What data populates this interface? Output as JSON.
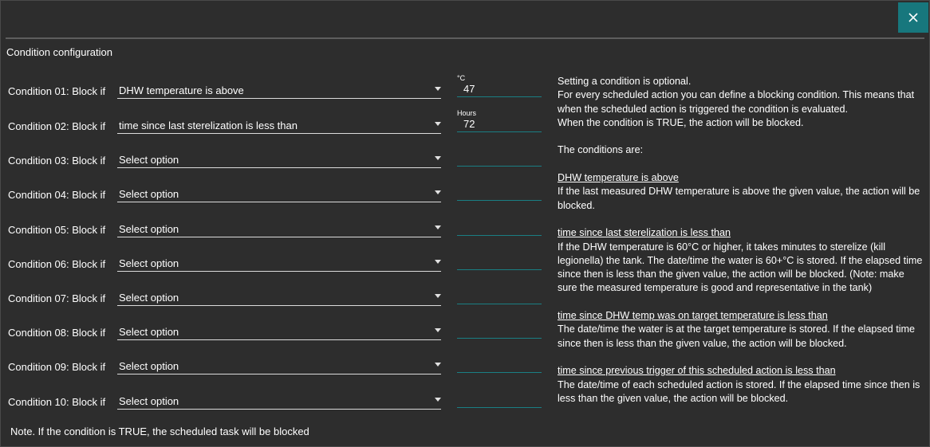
{
  "dialog": {
    "close_icon": "close-icon",
    "section_title": "Condition configuration",
    "accent_color": "#17777d"
  },
  "conditions": [
    {
      "label": "Condition 01: Block if",
      "selected": "DHW temperature is above",
      "unit": "°C",
      "value": "47"
    },
    {
      "label": "Condition 02: Block if",
      "selected": "time since last sterelization is less than",
      "unit": "Hours",
      "value": "72"
    },
    {
      "label": "Condition 03: Block if",
      "selected": "Select option",
      "unit": "",
      "value": ""
    },
    {
      "label": "Condition 04: Block if",
      "selected": "Select option",
      "unit": "",
      "value": ""
    },
    {
      "label": "Condition 05: Block if",
      "selected": "Select option",
      "unit": "",
      "value": ""
    },
    {
      "label": "Condition 06: Block if",
      "selected": "Select option",
      "unit": "",
      "value": ""
    },
    {
      "label": "Condition 07: Block if",
      "selected": "Select option",
      "unit": "",
      "value": ""
    },
    {
      "label": "Condition 08: Block if",
      "selected": "Select option",
      "unit": "",
      "value": ""
    },
    {
      "label": "Condition 09: Block if",
      "selected": "Select option",
      "unit": "",
      "value": ""
    },
    {
      "label": "Condition 10: Block if",
      "selected": "Select option",
      "unit": "",
      "value": ""
    }
  ],
  "help": {
    "intro_1": "Setting a condition is optional.",
    "intro_2": "For every scheduled action you can define a blocking condition. This means that when the scheduled action is triggered the condition is evaluated.",
    "intro_3": "When the condition is TRUE, the action will be blocked.",
    "conditions_are": "The conditions are:",
    "items": [
      {
        "title": "DHW temperature is above",
        "text": "If the last measured DHW temperature is above the given value, the action will be blocked."
      },
      {
        "title": "time since last sterelization is less than",
        "text": "If the DHW temperature is 60°C or higher, it takes minutes to sterelize (kill legionella) the tank. The date/time the water is 60+°C is stored. If the elapsed time since then is less than the given value, the action will be blocked. (Note: make sure the measured temperature is good and representative in the tank)"
      },
      {
        "title": "time since DHW temp was on target temperature is less than",
        "text": "The date/time the water is at the target temperature is stored. If the elapsed time since then is less than the given value, the action will be blocked."
      },
      {
        "title": "time since previous trigger of this scheduled action is less than",
        "text": "The date/time of each scheduled action is stored. If the elapsed time since then is less than the given value, the action will be blocked."
      }
    ]
  },
  "note": "Note. If the condition is TRUE, the scheduled task will be blocked"
}
